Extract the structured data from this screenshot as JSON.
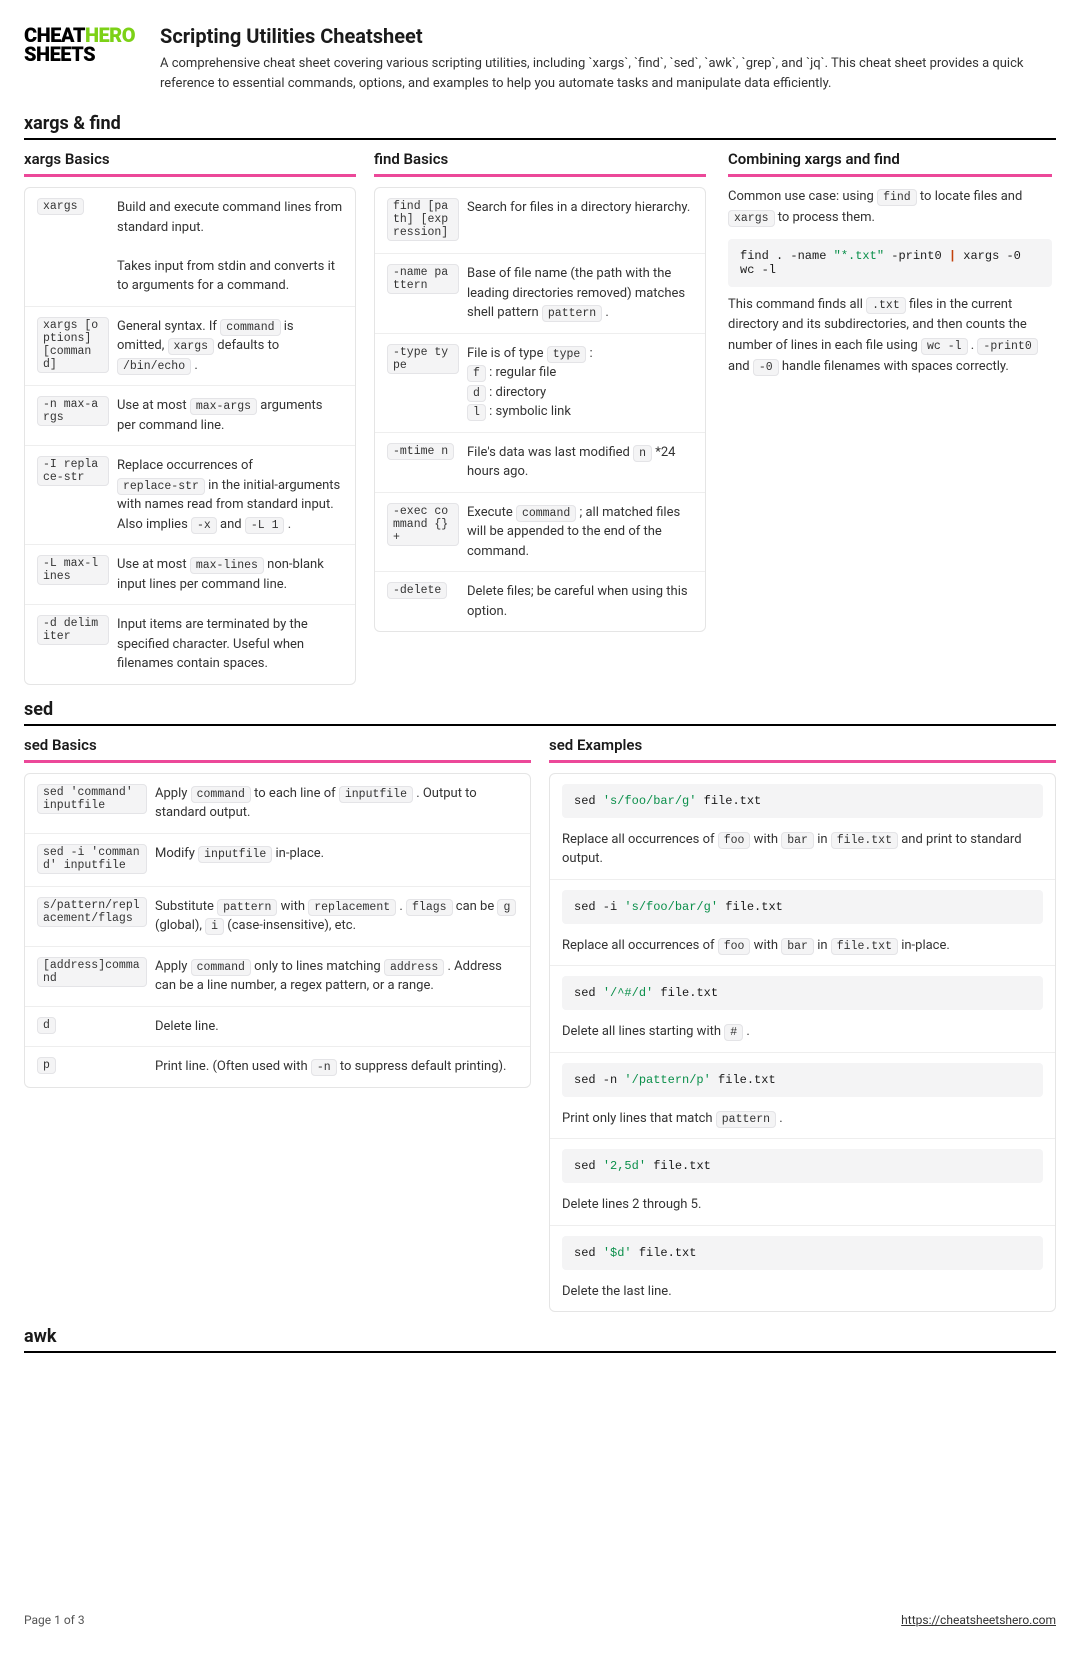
{
  "logo": {
    "line1": "CHEAT",
    "line2": "SHEETS",
    "accent": "HERO"
  },
  "title": "Scripting Utilities Cheatsheet",
  "subtitle": "A comprehensive cheat sheet covering various scripting utilities, including `xargs`, `find`, `sed`, `awk`, `grep`, and `jq`. This cheat sheet provides a quick reference to essential commands, options, and examples to help you automate tasks and manipulate data efficiently.",
  "sections": {
    "xargs_find": {
      "heading": "xargs & find",
      "xargs_basics": {
        "title": "xargs Basics",
        "rows": [
          {
            "term": "xargs",
            "desc": "Build and execute command lines from standard input.\n\nTakes input from stdin and converts it to arguments for a command."
          },
          {
            "term": "xargs [options] [command]",
            "desc_parts": [
              "General syntax. If ",
              "command",
              " is omitted, ",
              "xargs",
              " defaults to ",
              "/bin/echo",
              " ."
            ]
          },
          {
            "term": "-n max-args",
            "desc_parts": [
              "Use at most ",
              "max-args",
              " arguments per command line."
            ]
          },
          {
            "term": "-I replace-str",
            "desc_parts": [
              "Replace occurrences of ",
              "replace-str",
              " in the initial-arguments with names read from standard input. Also implies ",
              "-x",
              " and ",
              "-L 1",
              " ."
            ]
          },
          {
            "term": "-L max-lines",
            "desc_parts": [
              "Use at most ",
              "max-lines",
              " non-blank input lines per command line."
            ]
          },
          {
            "term": "-d delimiter",
            "desc": "Input items are terminated by the specified character. Useful when filenames contain spaces."
          }
        ]
      },
      "find_basics": {
        "title": "find Basics",
        "rows": [
          {
            "term": "find [path] [expression]",
            "desc": "Search for files in a directory hierarchy."
          },
          {
            "term": "-name pattern",
            "desc_parts": [
              "Base of file name (the path with the leading directories removed) matches shell pattern ",
              "pattern",
              " ."
            ]
          },
          {
            "term": "-type type",
            "desc_multi": [
              [
                "File is of type ",
                "type",
                " :"
              ],
              [
                "",
                "f",
                " : regular file"
              ],
              [
                "",
                "d",
                " : directory"
              ],
              [
                "",
                "l",
                " : symbolic link"
              ]
            ]
          },
          {
            "term": "-mtime n",
            "desc_parts": [
              "File's data was last modified ",
              "n",
              " *24 hours ago."
            ]
          },
          {
            "term": "-exec command {} +",
            "desc_parts": [
              "Execute ",
              "command",
              " ; all matched files will be appended to the end of the command."
            ]
          },
          {
            "term": "-delete",
            "desc": "Delete files; be careful when using this option."
          }
        ]
      },
      "combining": {
        "title": "Combining xargs and find",
        "intro_parts": [
          "Common use case: using ",
          "find",
          " to locate files and ",
          "xargs",
          " to process them."
        ],
        "code": {
          "plain1": "find . -name ",
          "str": "\"*.txt\"",
          "plain2": " -print0 ",
          "pipe": "|",
          "plain3": " xargs -0 wc -l"
        },
        "explain_parts": [
          "This command finds all ",
          ".txt",
          " files in the current directory and its subdirectories, and then counts the number of lines in each file using ",
          "wc -l",
          " . ",
          "-print0",
          " and ",
          "-0",
          " handle filenames with spaces correctly."
        ]
      }
    },
    "sed": {
      "heading": "sed",
      "basics": {
        "title": "sed Basics",
        "rows": [
          {
            "term": "sed 'command' inputfile",
            "desc_parts": [
              "Apply ",
              "command",
              " to each line of ",
              "inputfile",
              " . Output to standard output."
            ]
          },
          {
            "term": "sed -i 'command' inputfile",
            "desc_parts": [
              "Modify ",
              "inputfile",
              " in-place."
            ]
          },
          {
            "term": "s/pattern/replacement/flags",
            "desc_parts": [
              "Substitute ",
              "pattern",
              " with ",
              "replacement",
              " . ",
              "flags",
              " can be ",
              "g",
              " (global), ",
              "i",
              " (case-insensitive), etc."
            ]
          },
          {
            "term": "[address]command",
            "desc_parts": [
              "Apply ",
              "command",
              " only to lines matching ",
              "address",
              " . Address can be a line number, a regex pattern, or a range."
            ]
          },
          {
            "term": "d",
            "desc": "Delete line."
          },
          {
            "term": "p",
            "desc_parts": [
              "Print line. (Often used with ",
              "-n",
              " to suppress default printing)."
            ]
          }
        ]
      },
      "examples": {
        "title": "sed Examples",
        "items": [
          {
            "code": {
              "p1": "sed ",
              "s": "'s/foo/bar/g'",
              "p2": " file.txt"
            },
            "caption_parts": [
              "Replace all occurrences of ",
              "foo",
              " with ",
              "bar",
              " in ",
              "file.txt",
              " and print to standard output."
            ]
          },
          {
            "code": {
              "p1": "sed -i ",
              "s": "'s/foo/bar/g'",
              "p2": " file.txt"
            },
            "caption_parts": [
              "Replace all occurrences of ",
              "foo",
              " with ",
              "bar",
              " in ",
              "file.txt",
              " in-place."
            ]
          },
          {
            "code": {
              "p1": "sed ",
              "s": "'/^#/d'",
              "p2": " file.txt"
            },
            "caption_parts": [
              "Delete all lines starting with ",
              "#",
              " ."
            ]
          },
          {
            "code": {
              "p1": "sed -n ",
              "s": "'/pattern/p'",
              "p2": " file.txt"
            },
            "caption_parts": [
              "Print only lines that match ",
              "pattern",
              " ."
            ]
          },
          {
            "code": {
              "p1": "sed ",
              "s": "'2,5d'",
              "p2": " file.txt"
            },
            "caption": "Delete lines 2 through 5."
          },
          {
            "code": {
              "p1": "sed ",
              "s": "'$d'",
              "p2": " file.txt"
            },
            "caption": "Delete the last line."
          }
        ]
      }
    },
    "awk": {
      "heading": "awk"
    }
  },
  "footer": {
    "page": "Page 1 of 3",
    "url": "https://cheatsheetshero.com"
  }
}
